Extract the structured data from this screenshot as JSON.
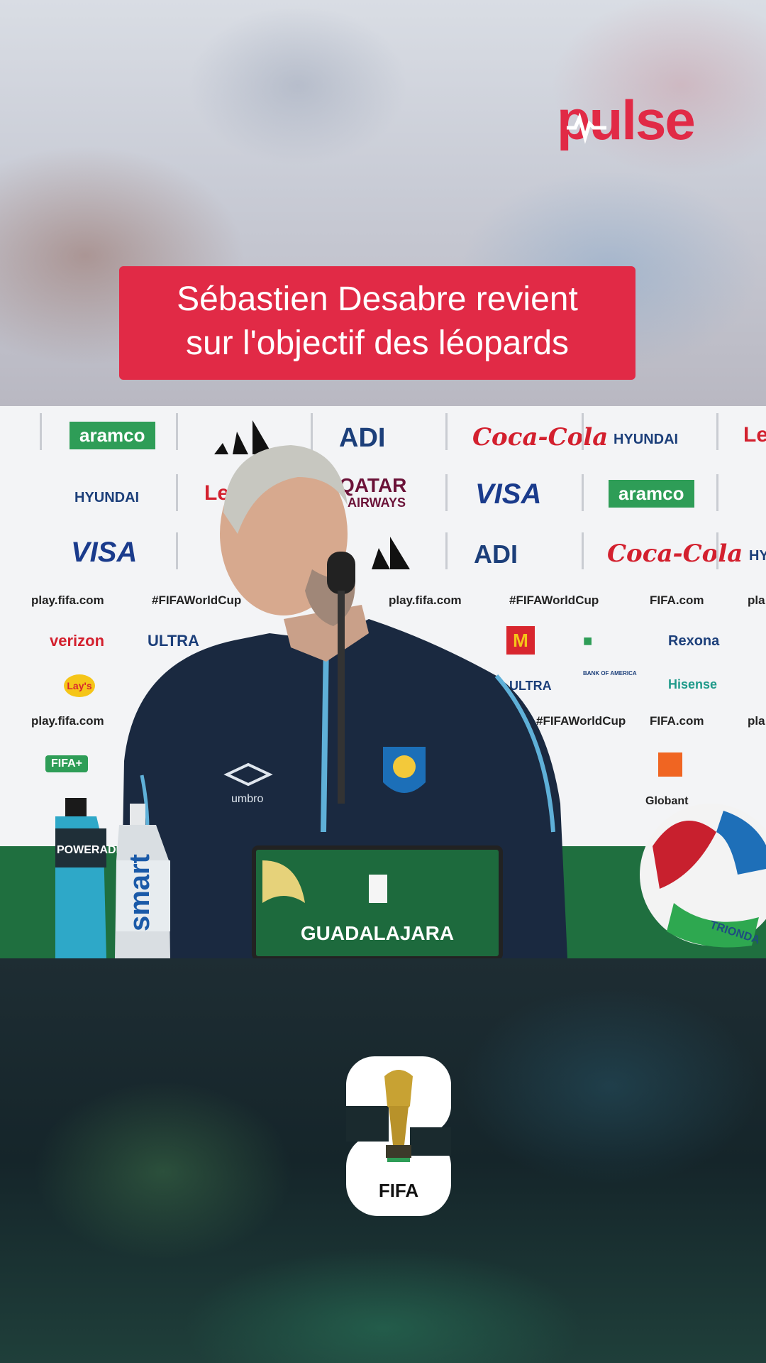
{
  "brand": {
    "name": "pulse",
    "color": "#e12a46"
  },
  "headline": {
    "line1": "Sébastien Desabre revient",
    "line2": "sur l'objectif des léopards"
  },
  "video": {
    "sponsors": {
      "row1": [
        "aramco",
        "ADI",
        "Coca-Cola",
        "HYUNDAI",
        "Le"
      ],
      "row2": [
        "HYUNDAI",
        "Lenovo",
        "QATAR",
        "AIRWAYS",
        "VISA",
        "aramco"
      ],
      "row3": [
        "VISA",
        "ADI",
        "Coca-Cola",
        "HY"
      ],
      "row4": [
        "play.fifa.com",
        "#FIFAWorldCup",
        "play.fifa.com",
        "#FIFAWorldCup",
        "FIFA.com",
        "pla"
      ],
      "row5": [
        "verizon",
        "ULTRA",
        "Rexona",
        "Lay's",
        "Hisense",
        "ULTRA",
        "BANK OF AMERICA"
      ],
      "row6": [
        "play.fifa.com",
        "#FIFAWorldCup",
        "FIFA.com",
        "pla",
        "FIFA+",
        "Globant"
      ]
    },
    "desk_sign": "GUADALAJARA",
    "bottle_powerade": "POWERADE",
    "bottle_smart": "smart",
    "jacket_brand": "umbro",
    "ball_label": "TRIONDA"
  },
  "footer_logo": {
    "text": "FIFA",
    "number": "26"
  }
}
